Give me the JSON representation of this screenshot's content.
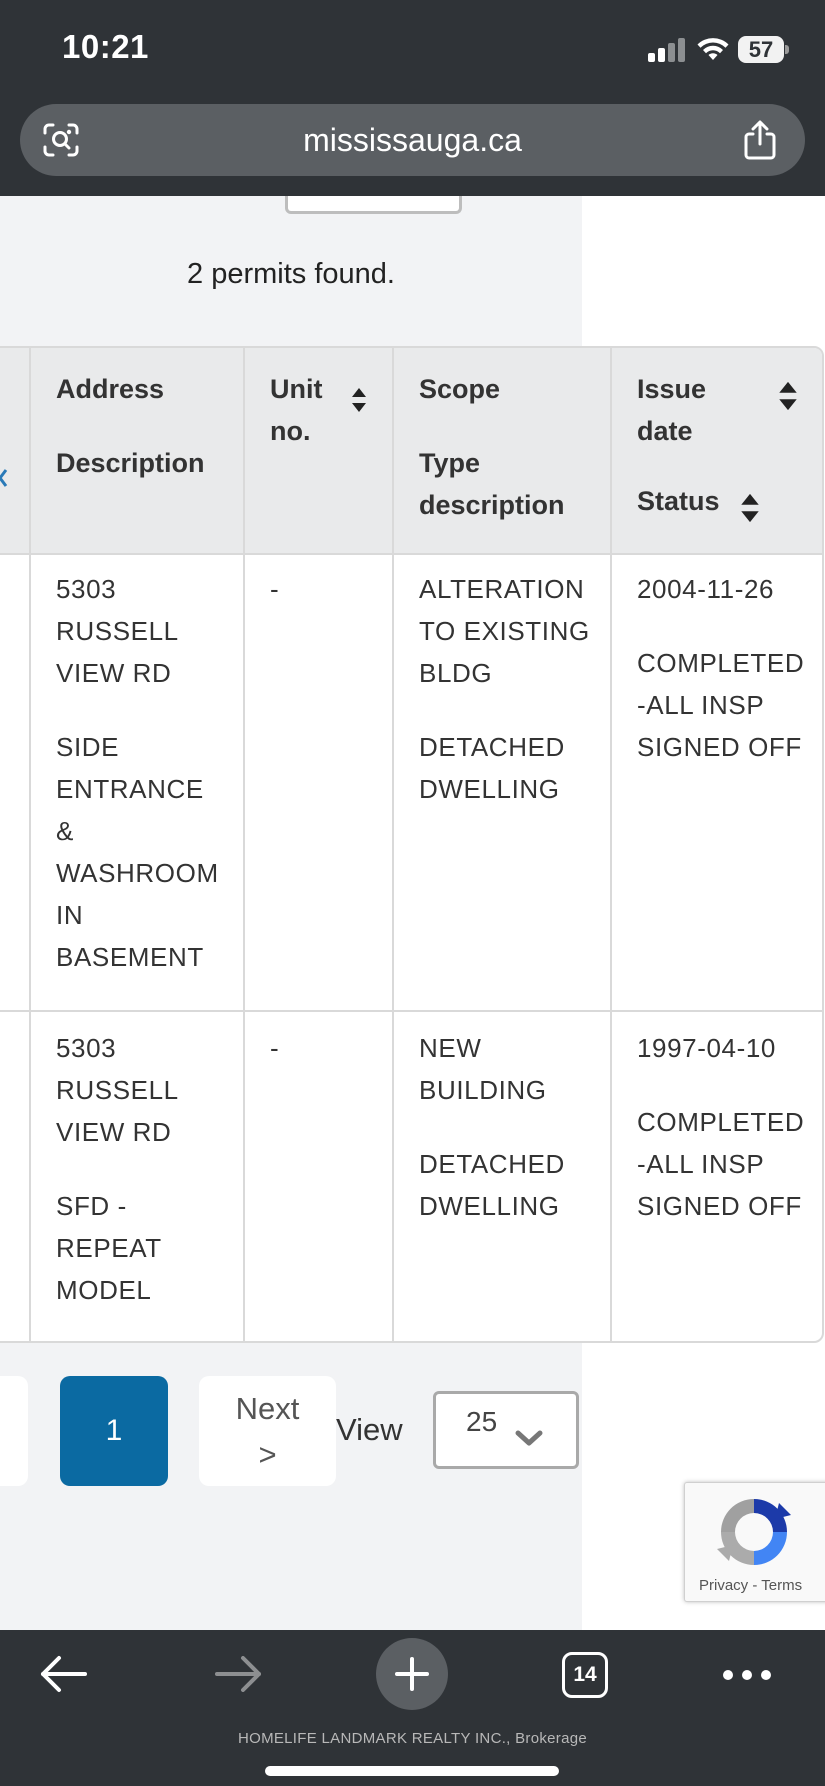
{
  "status_bar": {
    "time": "10:21",
    "battery": "57"
  },
  "browser": {
    "url": "mississauga.ca",
    "tabs_count": "14"
  },
  "results": {
    "summary": "2 permits found."
  },
  "table": {
    "headers": {
      "address": "Address",
      "description": "Description",
      "unit": "Unit\nno.",
      "scope": "Scope",
      "type_description": "Type\ndescription",
      "issue_date": "Issue\ndate",
      "status": "Status"
    },
    "rows": [
      {
        "address": "5303\nRUSSELL\nVIEW RD",
        "description": "SIDE\nENTRANCE\n&\nWASHROOM\nIN\nBASEMENT",
        "unit": "-",
        "scope": "ALTERATION\nTO EXISTING\nBLDG",
        "type": "DETACHED\nDWELLING",
        "issue_date": "2004-11-26",
        "status": "COMPLETED\n-ALL INSP\nSIGNED OFF"
      },
      {
        "address": "5303\nRUSSELL\nVIEW RD",
        "description": "SFD -\nREPEAT\nMODEL",
        "unit": "-",
        "scope": "NEW\nBUILDING",
        "type": "DETACHED\nDWELLING",
        "issue_date": "1997-04-10",
        "status": "COMPLETED\n-ALL INSP\nSIGNED OFF"
      }
    ]
  },
  "pagination": {
    "current_page": "1",
    "next_label": "Next\n>",
    "view_label": "View",
    "page_size": "25"
  },
  "recaptcha": {
    "links": "Privacy - Terms"
  },
  "footer": {
    "brokerage": "HOMELIFE LANDMARK REALTY INC., Brokerage"
  },
  "colors": {
    "chrome": "#2f3337",
    "accent_button": "#0b6aa2",
    "header_bg": "#e9eaeb",
    "panel_bg": "#f2f3f5"
  },
  "icons": [
    "signal-icon",
    "wifi-icon",
    "battery-icon",
    "lens-icon",
    "share-icon",
    "sort-icon",
    "chevron-down-icon",
    "back-arrow-icon",
    "forward-arrow-icon",
    "plus-icon",
    "more-icon",
    "recaptcha-logo-icon"
  ]
}
